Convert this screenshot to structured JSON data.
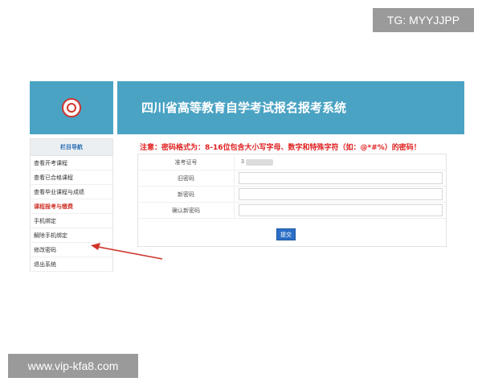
{
  "watermarks": {
    "top": "TG: MYYJJPP",
    "bottom": "www.vip-kfa8.com"
  },
  "header": {
    "title": "四川省高等教育自学考试报名报考系统"
  },
  "sidebar": {
    "heading": "栏目导航",
    "items": [
      {
        "label": "查看开考课程"
      },
      {
        "label": "查看已合格课程"
      },
      {
        "label": "查看毕业课程与成绩"
      },
      {
        "label": "课程报考与缴费"
      },
      {
        "label": "手机绑定"
      },
      {
        "label": "解除手机绑定"
      },
      {
        "label": "修改密码"
      },
      {
        "label": "退出系统"
      }
    ]
  },
  "notice": "注意：密码格式为：8-16位包含大小写字母、数字和特殊字符（如：@*#%）的密码！",
  "form": {
    "rows": [
      {
        "label": "准考证号",
        "value": "3"
      },
      {
        "label": "旧密码",
        "value": ""
      },
      {
        "label": "新密码",
        "value": ""
      },
      {
        "label": "确认新密码",
        "value": ""
      }
    ],
    "submit_label": "提交"
  },
  "colors": {
    "header_bg": "#4aa3c3",
    "notice": "#e02020",
    "active_item": "#d0342c",
    "annotation_arrow": "#d0342c",
    "submit_bg": "#2b6fc7"
  }
}
